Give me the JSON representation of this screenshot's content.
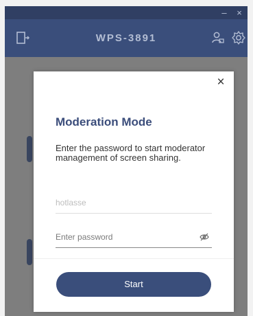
{
  "app": {
    "title": "WPS-3891",
    "window_controls": {
      "minimize": "–",
      "close": "×"
    }
  },
  "toolbar": {
    "left_icon": "exit-icon",
    "right_icons": [
      "user-lock-icon",
      "gear-icon"
    ]
  },
  "modal": {
    "close_label": "×",
    "title": "Moderation Mode",
    "description": "Enter the password to start moderator management of screen sharing.",
    "field_1": {
      "placeholder": "hotlasse",
      "value": ""
    },
    "field_2": {
      "placeholder": "Enter password",
      "value": ""
    },
    "eye_icon": "eye-slash-icon",
    "start_label": "Start"
  },
  "colors": {
    "brand": "#3a4e7b",
    "titlebar": "#303f63",
    "overlay": "#7e7e7e"
  }
}
